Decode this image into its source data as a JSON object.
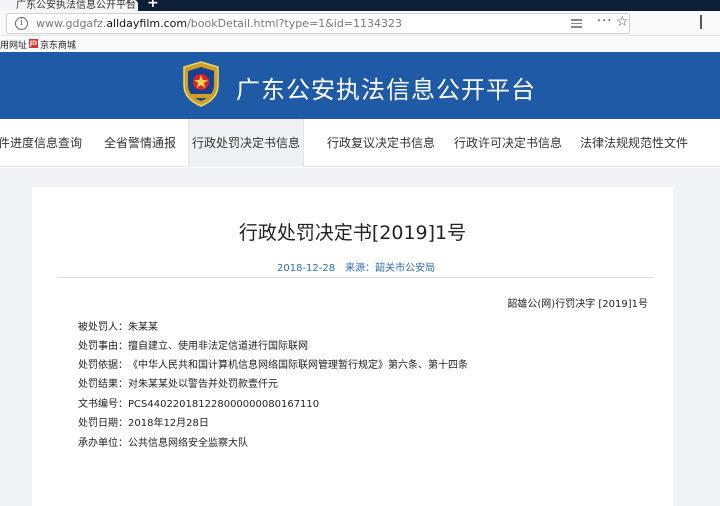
{
  "browser": {
    "tab_title": "广东公安执法信息公开平台",
    "new_tab": "+",
    "tab_close": "×",
    "url_prefix": "www.gdgafz.",
    "url_domain": "alldayfilm.com",
    "url_path": "/bookDetail.html?type=1&id=1134323",
    "bookmarks": [
      "用网址",
      "京东商城"
    ],
    "bookmark_icon": "JD"
  },
  "site": {
    "title": "广东公安执法信息公开平台"
  },
  "nav": {
    "items": [
      "件进度信息查询",
      "全省警情通报",
      "行政处罚决定书信息",
      "行政复议决定书信息",
      "行政许可决定书信息",
      "法律法规规范性文件"
    ],
    "active_index": 2
  },
  "document": {
    "title": "行政处罚决定书[2019]1号",
    "date": "2018-12-28",
    "source": "来源：韶关市公安局",
    "doc_number": "韶雄公(网)行罚决字 [2019]1号",
    "fields": [
      {
        "label": "被处罚人：",
        "value": "朱某某"
      },
      {
        "label": "处罚事由：",
        "value": "擅自建立、使用非法定信道进行国际联网"
      },
      {
        "label": "处罚依据：",
        "value": "《中华人民共和国计算机信息网络国际联网管理暂行规定》第六条、第十四条"
      },
      {
        "label": "处罚结果：",
        "value": "对朱某某处以警告并处罚款壹仟元"
      },
      {
        "label": "文书编号：",
        "value": "PCS440220181228000000080167110"
      },
      {
        "label": "处罚日期：",
        "value": "2018年12月28日"
      },
      {
        "label": "承办单位：",
        "value": "公共信息网络安全监察大队"
      }
    ]
  },
  "colors": {
    "banner": "#1e5aa6",
    "meta_link": "#2d6db5",
    "page_bg": "#f1f3f6"
  }
}
